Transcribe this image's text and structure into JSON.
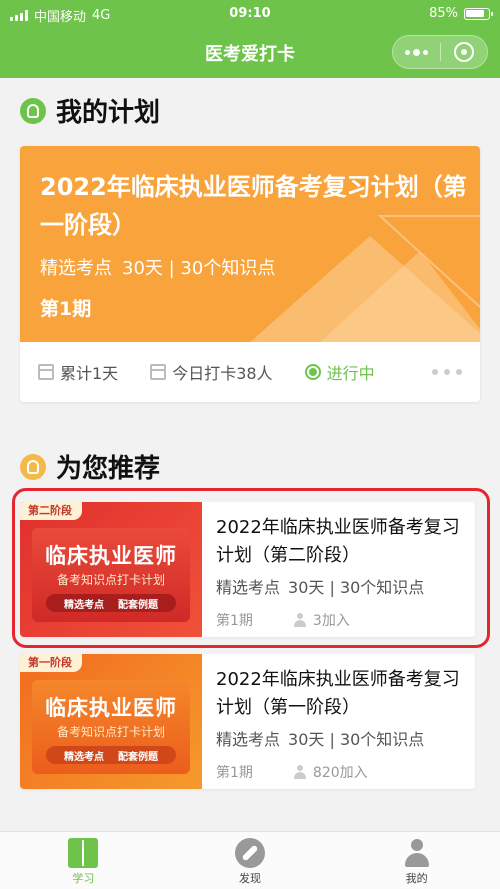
{
  "status_bar": {
    "carrier": "中国移动",
    "network": "4G",
    "time": "09:10",
    "battery_text": "85%",
    "battery_level": 0.85
  },
  "nav": {
    "title": "医考爱打卡"
  },
  "my_plan": {
    "header": "我的计划",
    "card": {
      "title": "2022年临床执业医师备考复习计划（第一阶段）",
      "meta_label": "精选考点",
      "meta_detail": "30天 | 30个知识点",
      "period": "第1期",
      "cumulative": "累计1天",
      "today_checkin": "今日打卡38人",
      "status": "进行中"
    }
  },
  "recommend": {
    "header": "为您推荐",
    "items": [
      {
        "tag": "第二阶段",
        "thumb_title": "临床执业医师",
        "thumb_sub": "备考知识点打卡计划",
        "thumb_pill_a": "精选考点",
        "thumb_pill_b": "配套例题",
        "title": "2022年临床执业医师备考复习计划（第二阶段）",
        "meta_label": "精选考点",
        "meta_detail": "30天 | 30个知识点",
        "period": "第1期",
        "joined": "3加入"
      },
      {
        "tag": "第一阶段",
        "thumb_title": "临床执业医师",
        "thumb_sub": "备考知识点打卡计划",
        "thumb_pill_a": "精选考点",
        "thumb_pill_b": "配套例题",
        "title": "2022年临床执业医师备考复习计划（第一阶段）",
        "meta_label": "精选考点",
        "meta_detail": "30天 | 30个知识点",
        "period": "第1期",
        "joined": "820加入"
      }
    ]
  },
  "tabbar": {
    "items": [
      {
        "label": "学习",
        "icon": "book-icon",
        "active": true
      },
      {
        "label": "发现",
        "icon": "compass-icon",
        "active": false
      },
      {
        "label": "我的",
        "icon": "user-icon",
        "active": false
      }
    ]
  },
  "colors": {
    "brand_green": "#6ec34a",
    "plan_orange": "#f8a33c",
    "highlight_red": "#e5262d"
  }
}
